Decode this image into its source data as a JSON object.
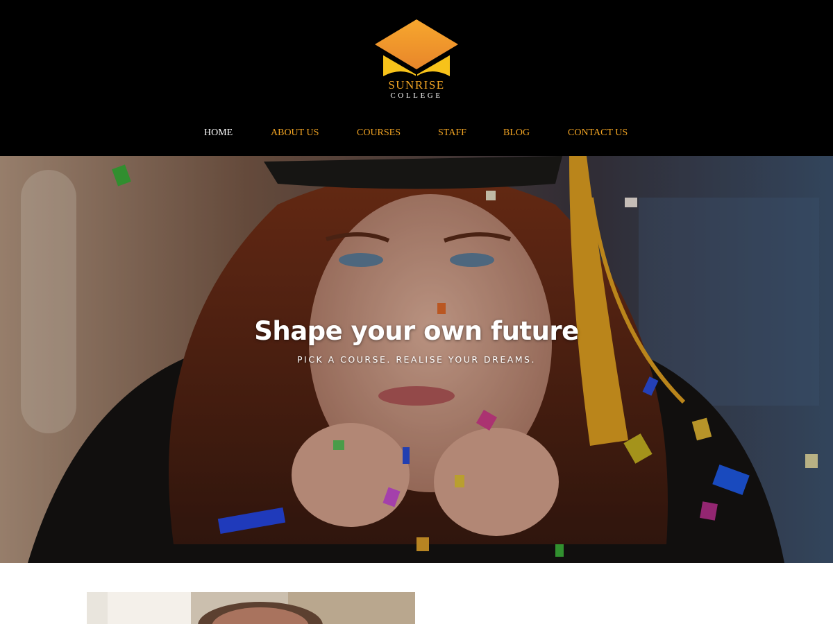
{
  "brand": {
    "name": "SUNRISE",
    "subtitle": "COLLEGE",
    "logo_icon": "graduation-cap-book-icon",
    "accent_color": "#f2a423"
  },
  "nav": {
    "items": [
      {
        "label": "HOME",
        "active": true
      },
      {
        "label": "ABOUT US",
        "active": false
      },
      {
        "label": "COURSES",
        "active": false
      },
      {
        "label": "STAFF",
        "active": false
      },
      {
        "label": "BLOG",
        "active": false
      },
      {
        "label": "CONTACT US",
        "active": false
      }
    ]
  },
  "hero": {
    "title": "Shape your own future",
    "subtitle": "PICK A COURSE. REALISE YOUR DREAMS."
  }
}
